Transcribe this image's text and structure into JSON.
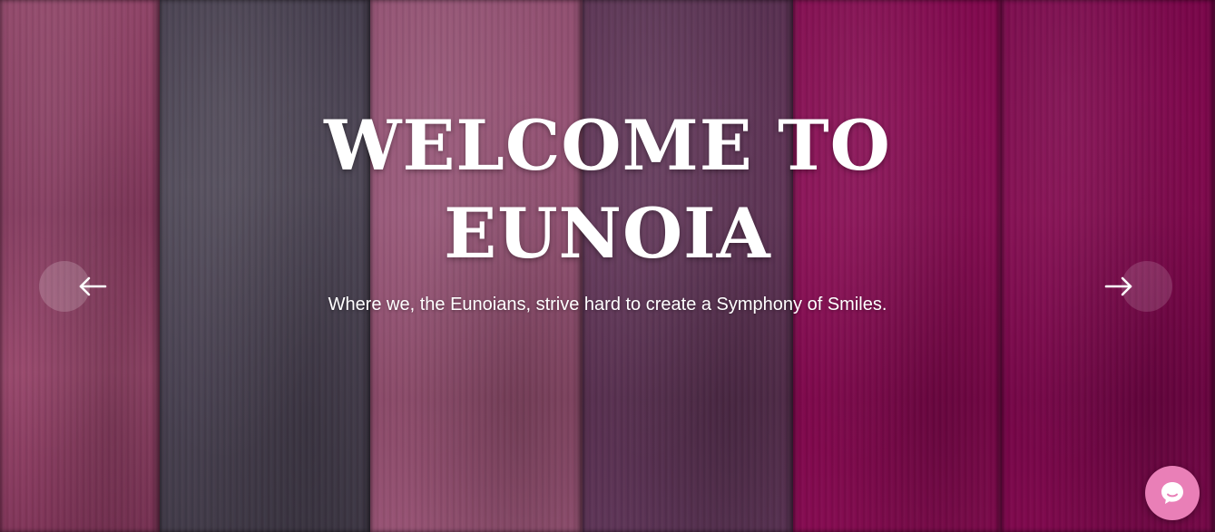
{
  "hero": {
    "title_line1": "WELCOME TO",
    "title_line2": "EUNOIA",
    "subtitle": "Where we, the Eunoians, strive hard to create a Symphony of Smiles."
  },
  "carousel": {
    "prev_icon": "arrow-left-icon",
    "next_icon": "arrow-right-icon"
  },
  "chat": {
    "icon": "chat-icon",
    "color": "#e97fb7"
  },
  "colors": {
    "text": "#ffffff",
    "plank_pink": "#9a4a6e",
    "plank_gray": "#4a4453",
    "plank_purple": "#5e3556",
    "plank_magenta": "#8a0a52"
  }
}
